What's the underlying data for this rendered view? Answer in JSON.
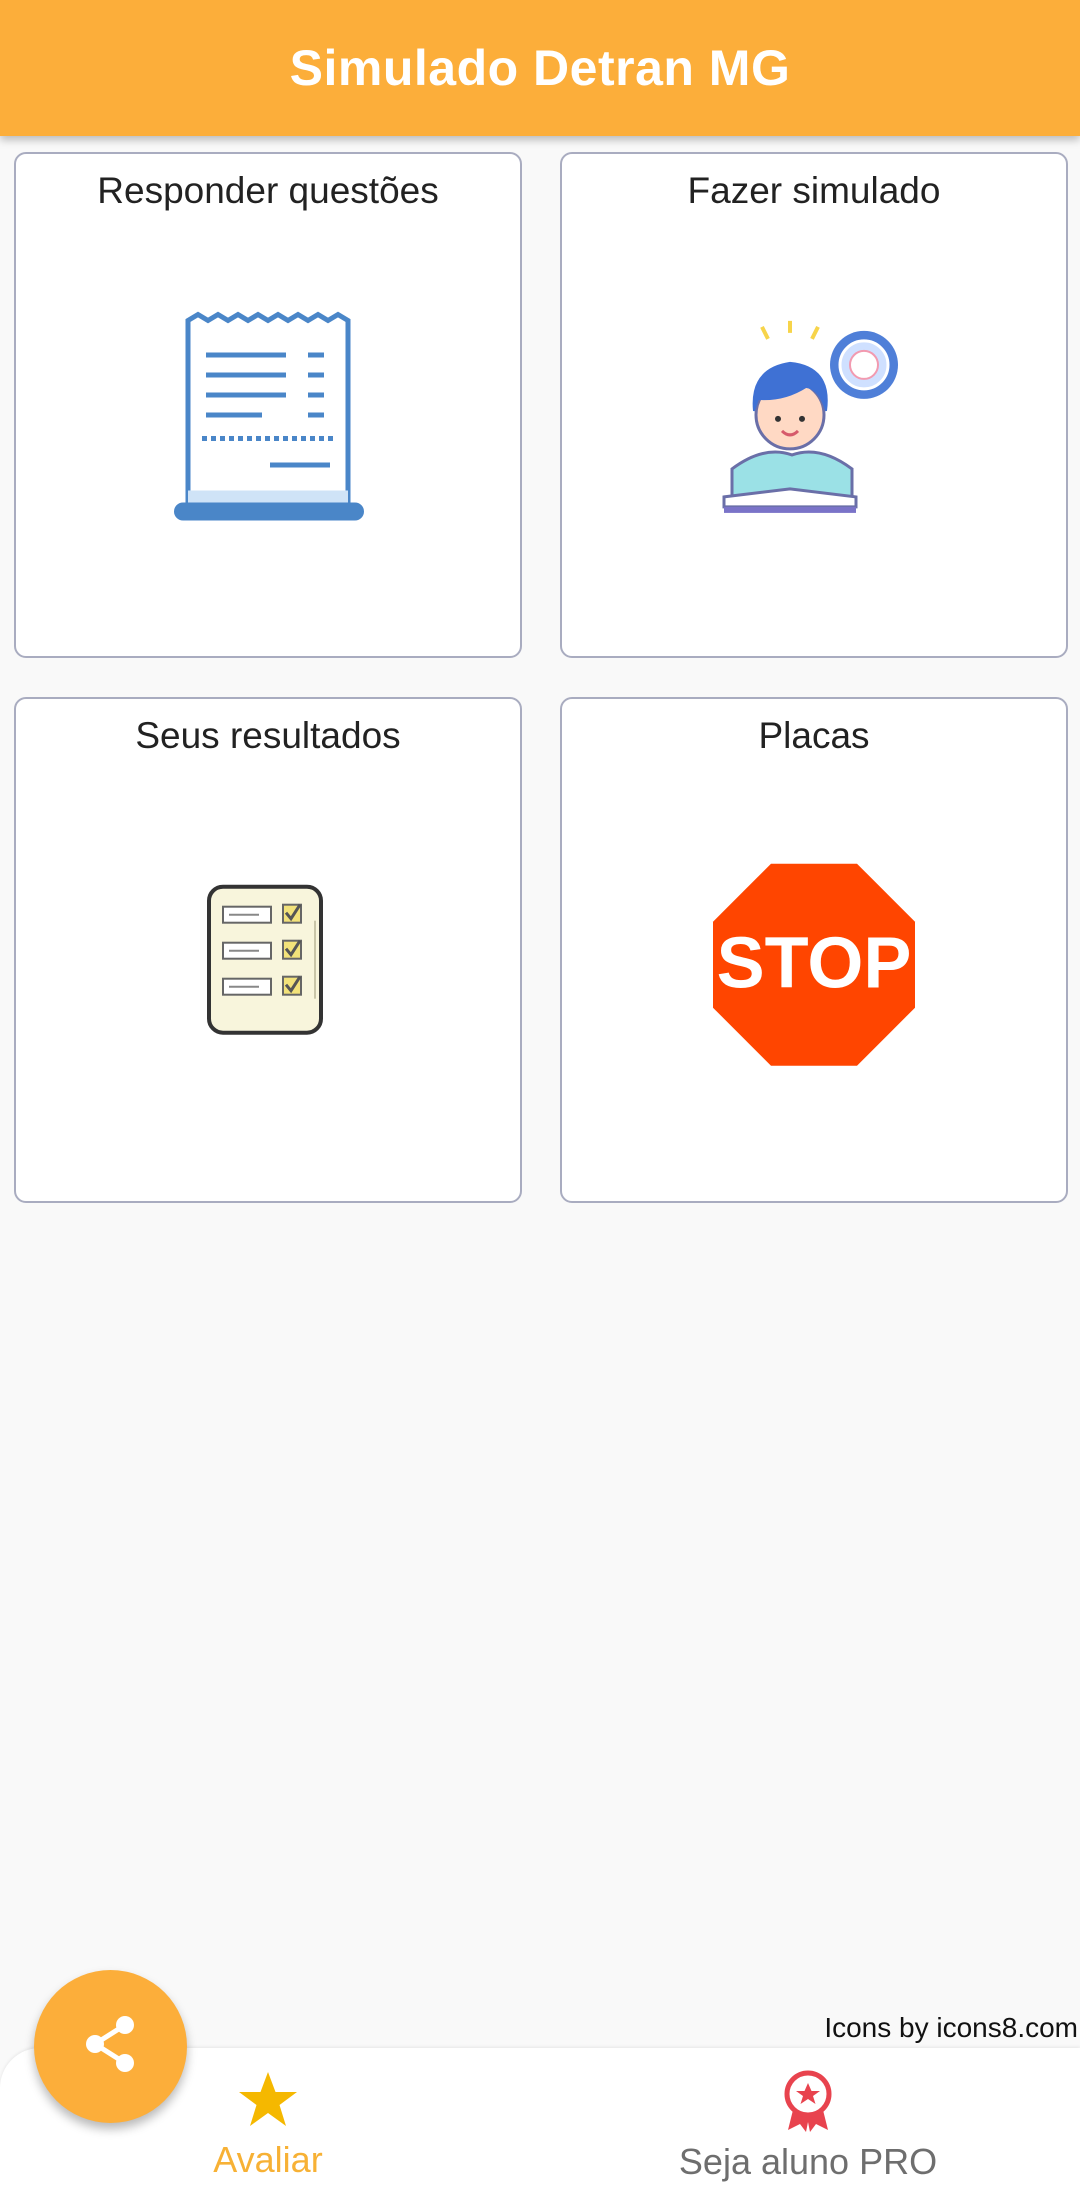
{
  "app_bar": {
    "title": "Simulado Detran MG"
  },
  "cards": [
    {
      "label": "Responder questões",
      "icon": "receipt-icon"
    },
    {
      "label": "Fazer simulado",
      "icon": "student-reading-icon"
    },
    {
      "label": "Seus resultados",
      "icon": "checklist-icon"
    },
    {
      "label": "Placas",
      "icon": "stop-sign-icon",
      "sign_text": "STOP"
    }
  ],
  "credit": "Icons by icons8.com",
  "bottom_nav": {
    "items": [
      {
        "label": "Avaliar",
        "icon": "star-icon",
        "active": true
      },
      {
        "label": "Seja aluno PRO",
        "icon": "award-ribbon-icon",
        "active": false
      }
    ]
  },
  "fab": {
    "icon": "share-icon"
  },
  "colors": {
    "primary": "#fcae3a",
    "star": "#f5b800",
    "stop_red": "#ff4500",
    "award_red": "#e8434e",
    "receipt_blue": "#4a86c8"
  }
}
